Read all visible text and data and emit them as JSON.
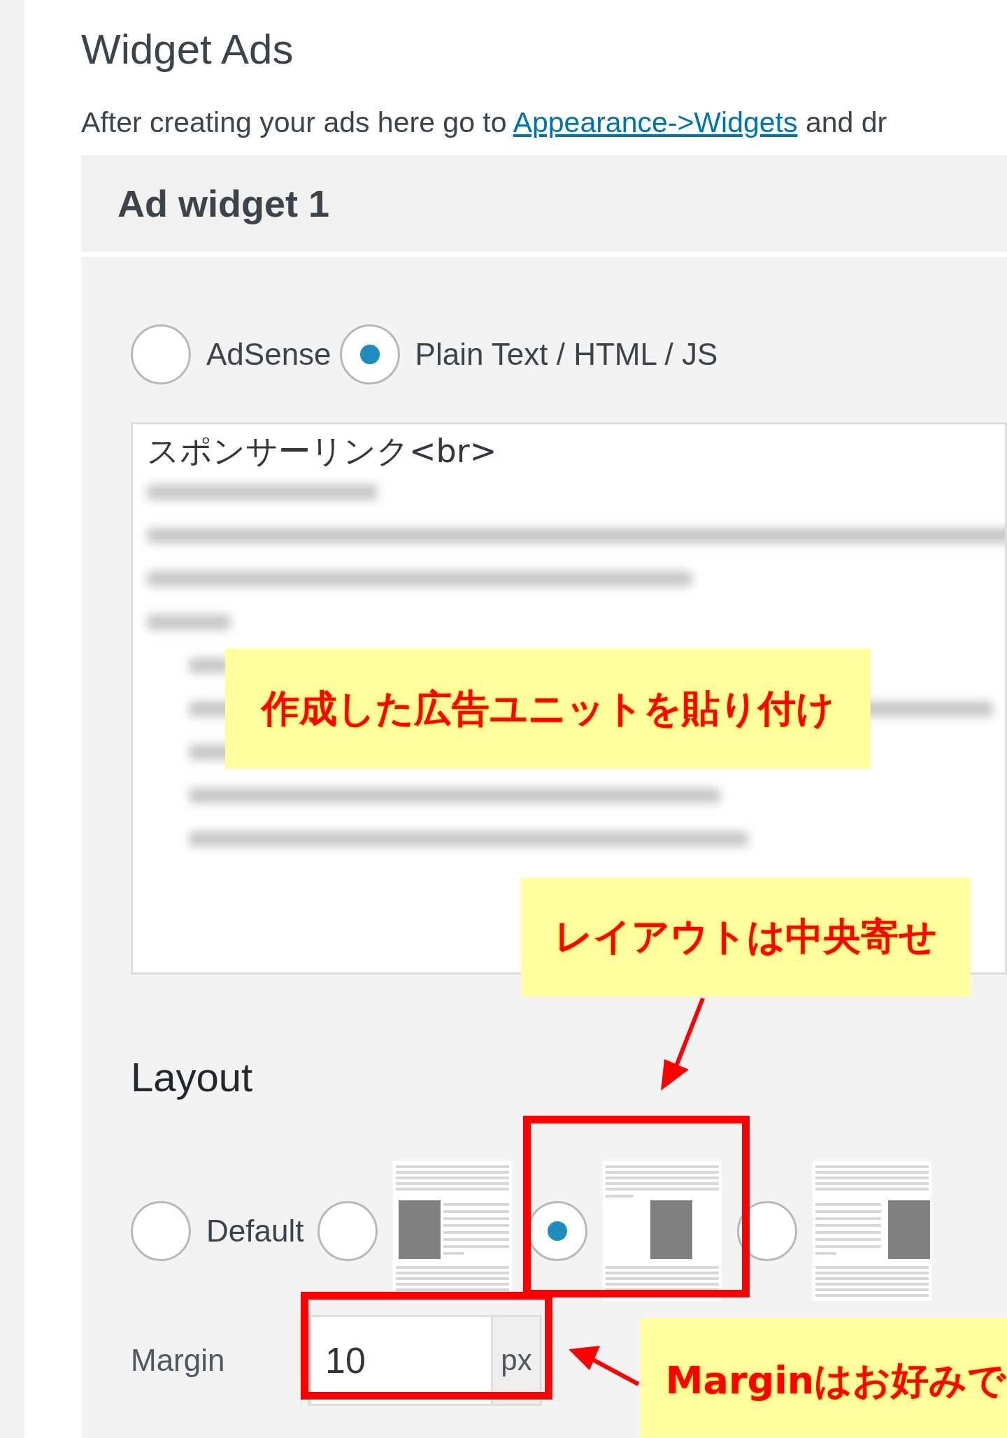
{
  "page": {
    "title": "Widget Ads",
    "intro": {
      "before": "After creating your ads here go to ",
      "link": "Appearance->Widgets",
      "after": " and dr"
    }
  },
  "widget": {
    "title": "Ad widget 1",
    "ad_types": [
      {
        "label": "AdSense",
        "selected": false
      },
      {
        "label": "Plain Text / HTML / JS",
        "selected": true
      }
    ],
    "code": {
      "value": "スポンサーリンク<br>"
    },
    "layout": {
      "title": "Layout",
      "options": [
        {
          "kind": "default",
          "label": "Default",
          "selected": false
        },
        {
          "kind": "left",
          "selected": false
        },
        {
          "kind": "center",
          "selected": true
        },
        {
          "kind": "right",
          "selected": false
        }
      ]
    },
    "margin": {
      "label": "Margin",
      "value": "10",
      "unit": "px"
    }
  },
  "callouts": [
    "作成した広告ユニットを貼り付け",
    "レイアウトは中央寄せ",
    "Marginはお好みで"
  ]
}
